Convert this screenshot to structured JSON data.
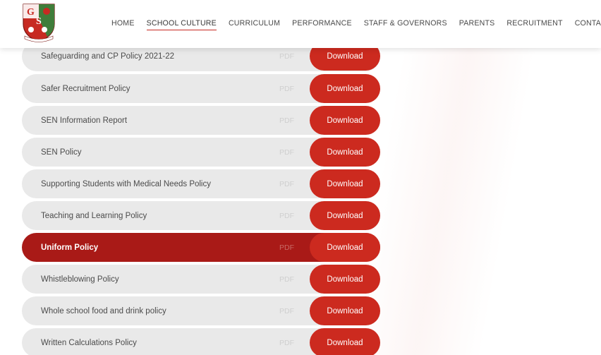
{
  "nav": {
    "items": [
      {
        "label": "HOME",
        "active": false
      },
      {
        "label": "SCHOOL CULTURE",
        "active": true
      },
      {
        "label": "CURRICULUM",
        "active": false
      },
      {
        "label": "PERFORMANCE",
        "active": false
      },
      {
        "label": "STAFF & GOVERNORS",
        "active": false
      },
      {
        "label": "PARENTS",
        "active": false
      },
      {
        "label": "RECRUITMENT",
        "active": false
      },
      {
        "label": "CONTACT US",
        "active": false
      }
    ]
  },
  "logo": {
    "letters": "GS",
    "banner": "",
    "brand_color": "#c72a22"
  },
  "documents": [
    {
      "title": "Safeguarding and CP Policy 2021-22",
      "type": "PDF",
      "button": "Download"
    },
    {
      "title": "Safer Recruitment Policy",
      "type": "PDF",
      "button": "Download"
    },
    {
      "title": "SEN Information Report",
      "type": "PDF",
      "button": "Download"
    },
    {
      "title": "SEN Policy",
      "type": "PDF",
      "button": "Download"
    },
    {
      "title": "Supporting Students with Medical Needs Policy",
      "type": "PDF",
      "button": "Download"
    },
    {
      "title": "Teaching and Learning Policy",
      "type": "PDF",
      "button": "Download"
    },
    {
      "title": "Uniform Policy",
      "type": "PDF",
      "button": "Download",
      "active": true
    },
    {
      "title": "Whistleblowing Policy",
      "type": "PDF",
      "button": "Download"
    },
    {
      "title": "Whole school food and drink policy",
      "type": "PDF",
      "button": "Download"
    },
    {
      "title": "Written Calculations Policy",
      "type": "PDF",
      "button": "Download"
    }
  ],
  "colors": {
    "accent": "#cc2a1f",
    "active_row": "#a91a17",
    "row_bg": "#e9e9e9"
  }
}
